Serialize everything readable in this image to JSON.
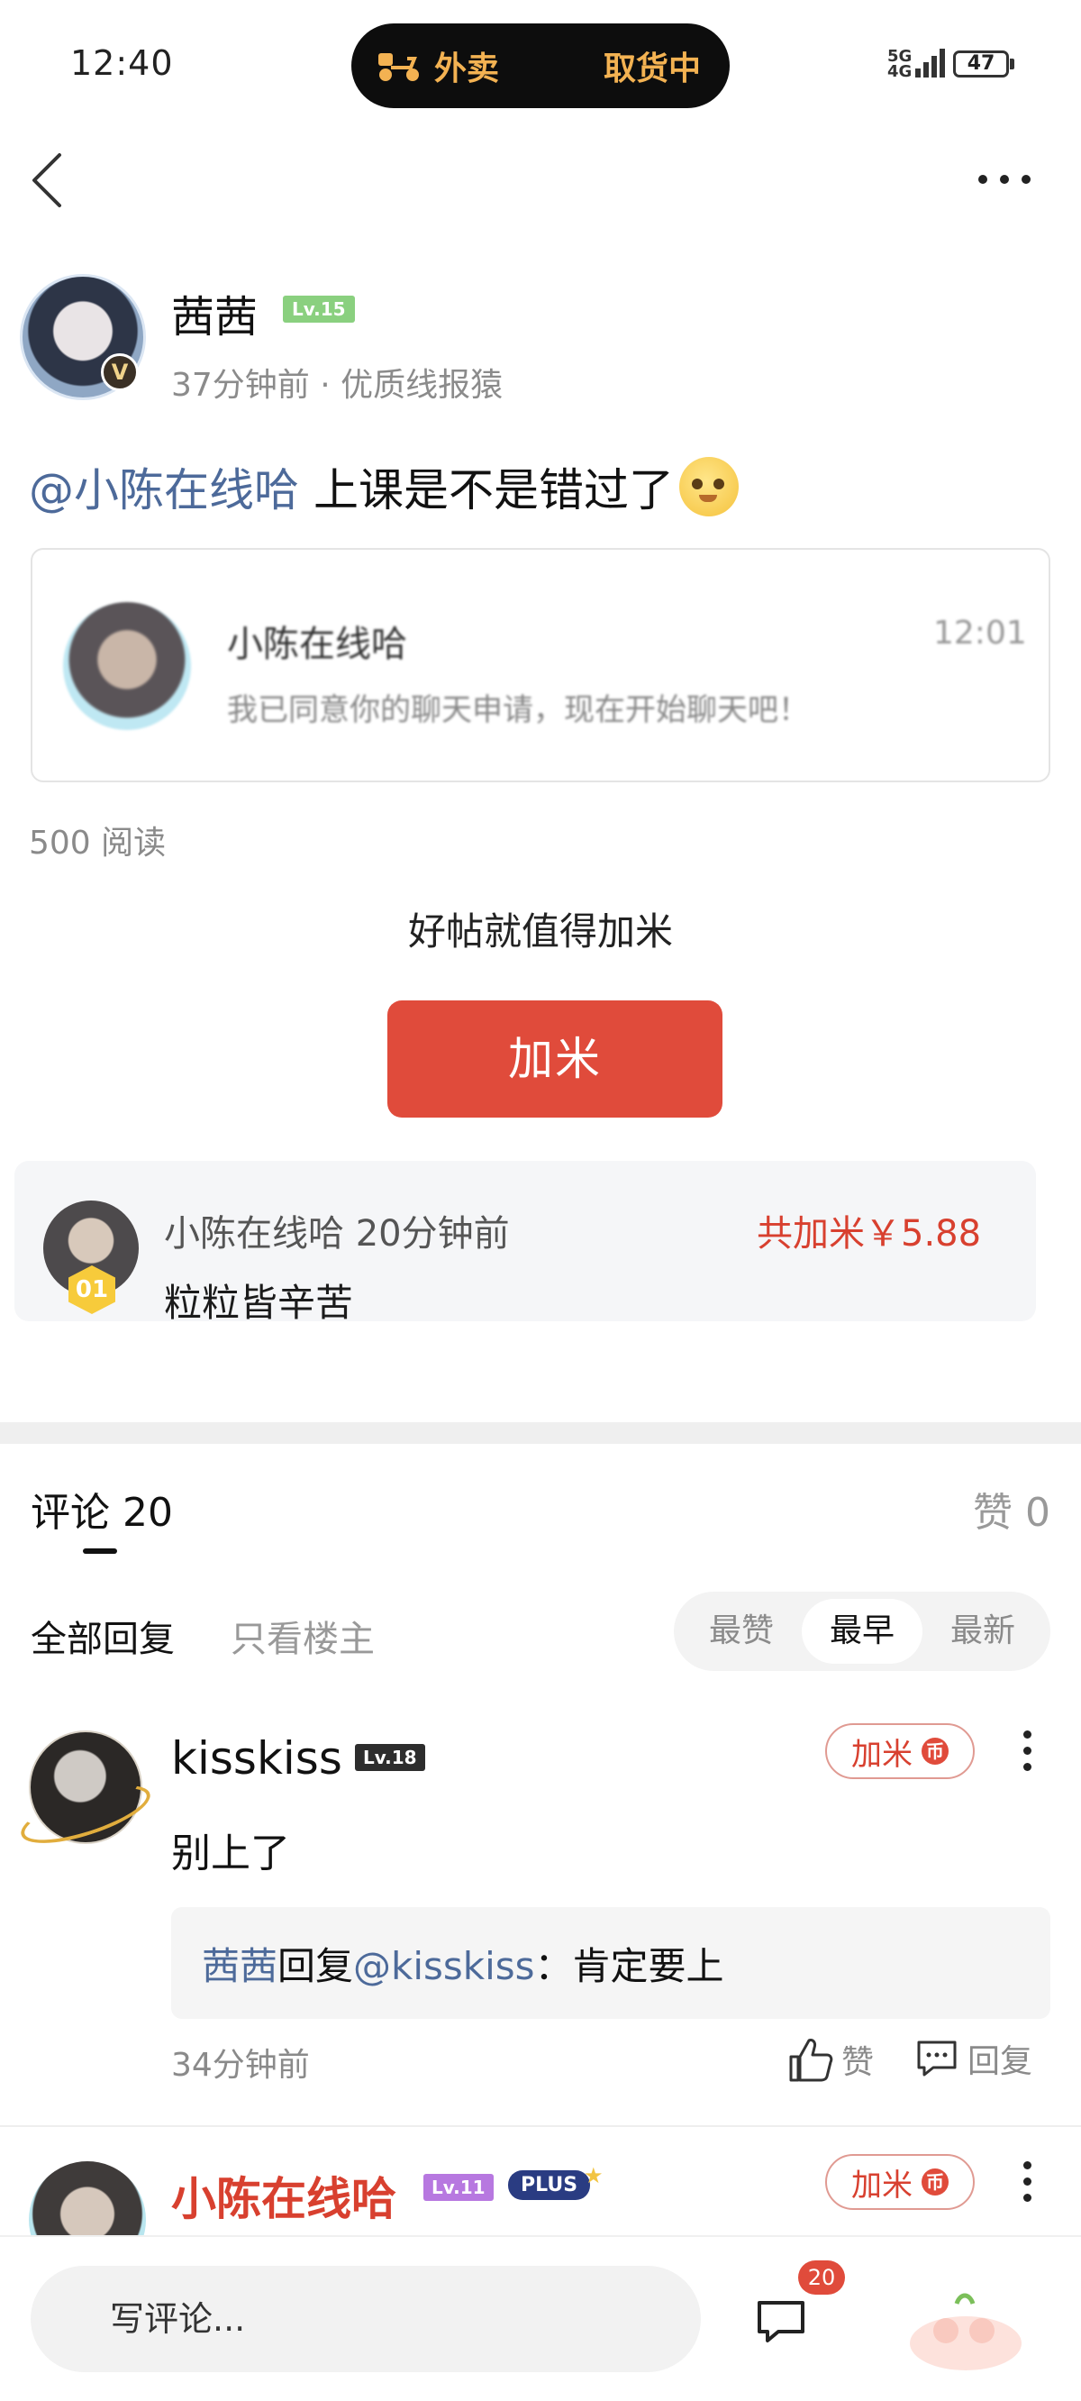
{
  "status_bar": {
    "time": "12:40",
    "island_left": "外卖",
    "island_right": "取货中",
    "network": [
      "5G",
      "4G"
    ],
    "battery": "47"
  },
  "post": {
    "author": "茜茜",
    "author_level": "Lv.15",
    "author_badge": "V",
    "meta": "37分钟前 · 优质线报猿",
    "mention": "@小陈在线哈",
    "text": "上课是不是错过了",
    "shared_card": {
      "name": "小陈在线哈",
      "time": "12:01",
      "message": "我已同意你的聊天申请，现在开始聊天吧！"
    },
    "reads": "500 阅读"
  },
  "reward": {
    "prompt": "好帖就值得加米",
    "button_label": "加米",
    "top_donor": {
      "rank": "01",
      "line": "小陈在线哈 20分钟前",
      "total": "共加米￥5.88",
      "message": "粒粒皆辛苦"
    }
  },
  "comments_header": {
    "title": "评论 20",
    "likes": "赞 0",
    "filter_all": "全部回复",
    "filter_op": "只看楼主",
    "sort_options": [
      "最赞",
      "最早",
      "最新"
    ],
    "sort_active": "最早"
  },
  "comments": [
    {
      "name": "kisskiss",
      "level": "Lv.18",
      "jiami_label": "加米",
      "jiami_coin": "币",
      "text": "别上了",
      "reply": {
        "from": "茜茜",
        "verb": "回复",
        "to": "@kisskiss",
        "content": "：肯定要上"
      },
      "time": "34分钟前",
      "like_label": "赞",
      "reply_label": "回复"
    },
    {
      "name": "小陈在线哈",
      "level": "Lv.11",
      "badge": "PLUS",
      "jiami_label": "加米",
      "jiami_coin": "币"
    }
  ],
  "bottom_bar": {
    "placeholder": "写评论...",
    "message_badge": "20"
  },
  "colors": {
    "accent_red": "#e04b3b",
    "link_blue": "#4d6a9a",
    "gold": "#f3b252"
  }
}
